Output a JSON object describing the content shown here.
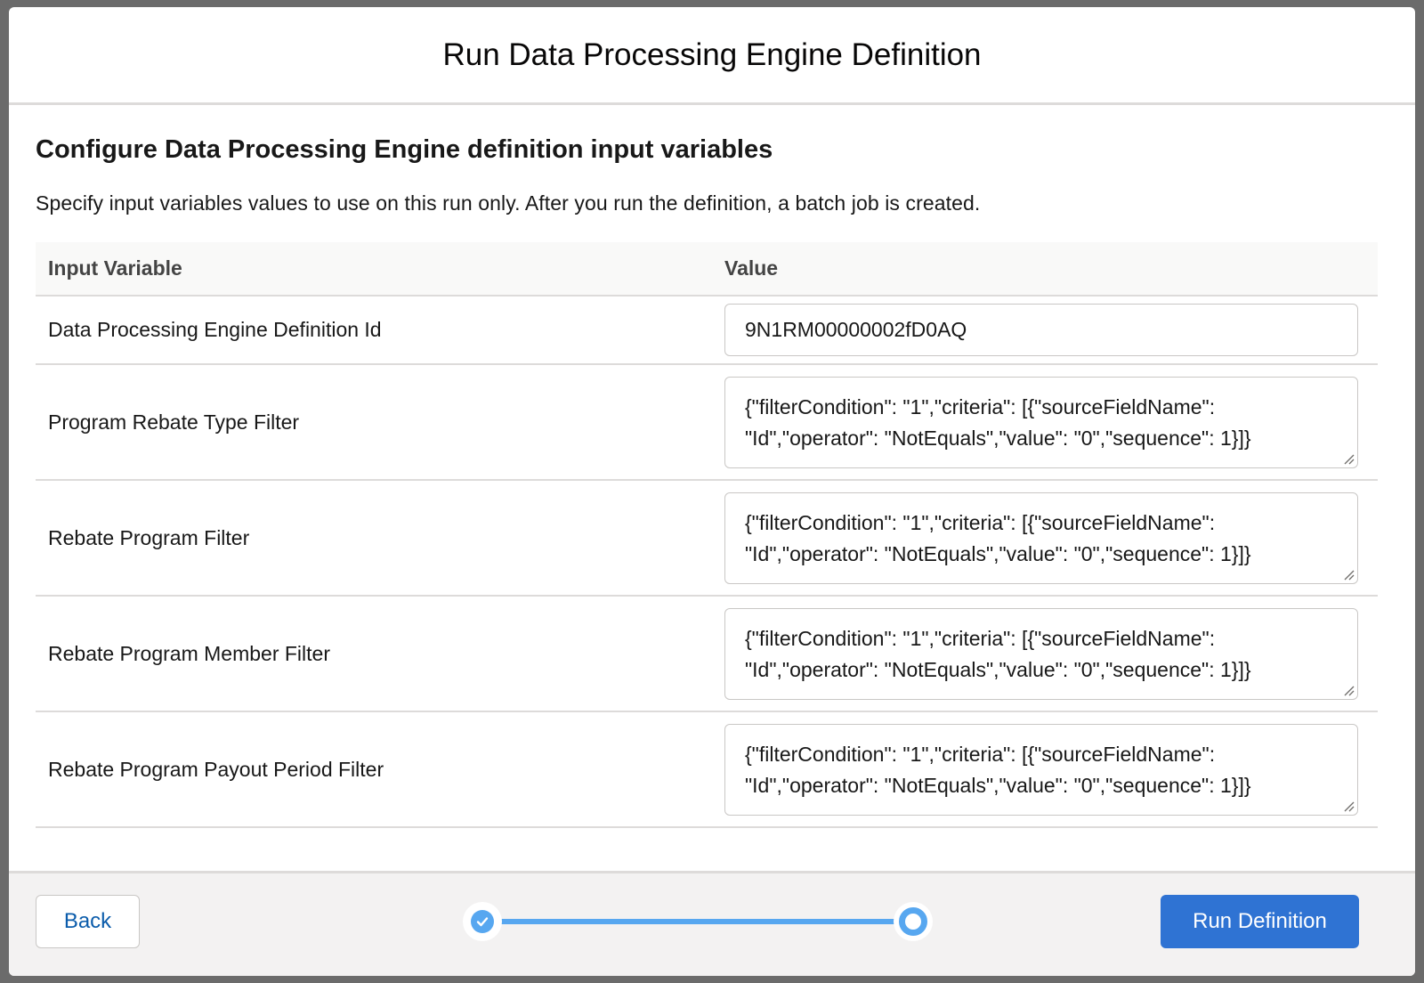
{
  "modal": {
    "title": "Run Data Processing Engine Definition"
  },
  "section": {
    "title": "Configure Data Processing Engine definition input variables",
    "description": "Specify input variables values to use on this run only. After you run the definition, a batch job is created."
  },
  "table": {
    "headers": {
      "name": "Input Variable",
      "value": "Value"
    },
    "rows": [
      {
        "name": "Data Processing Engine Definition Id",
        "value": "9N1RM00000002fD0AQ"
      },
      {
        "name": "Program Rebate Type Filter",
        "value_line1": "{\"filterCondition\": \"1\",\"criteria\": [{\"sourceFieldName\":",
        "value_line2": "\"Id\",\"operator\": \"NotEquals\",\"value\": \"0\",\"sequence\": 1}]}"
      },
      {
        "name": "Rebate Program Filter",
        "value_line1": "{\"filterCondition\": \"1\",\"criteria\": [{\"sourceFieldName\":",
        "value_line2": "\"Id\",\"operator\": \"NotEquals\",\"value\": \"0\",\"sequence\": 1}]}"
      },
      {
        "name": "Rebate Program Member Filter",
        "value_line1": "{\"filterCondition\": \"1\",\"criteria\": [{\"sourceFieldName\":",
        "value_line2": "\"Id\",\"operator\": \"NotEquals\",\"value\": \"0\",\"sequence\": 1}]}"
      },
      {
        "name": "Rebate Program Payout Period Filter",
        "value_line1": "{\"filterCondition\": \"1\",\"criteria\": [{\"sourceFieldName\":",
        "value_line2": "\"Id\",\"operator\": \"NotEquals\",\"value\": \"0\",\"sequence\": 1}]}"
      }
    ]
  },
  "footer": {
    "back_label": "Back",
    "run_label": "Run Definition",
    "progress": {
      "steps": 2,
      "current_step": 2,
      "icons": [
        "check-icon",
        "current-step-ring-icon"
      ]
    }
  },
  "colors": {
    "brand": "#2f73d3",
    "progress": "#57a7f0",
    "link": "#0b5cab",
    "border": "#dddbda"
  }
}
